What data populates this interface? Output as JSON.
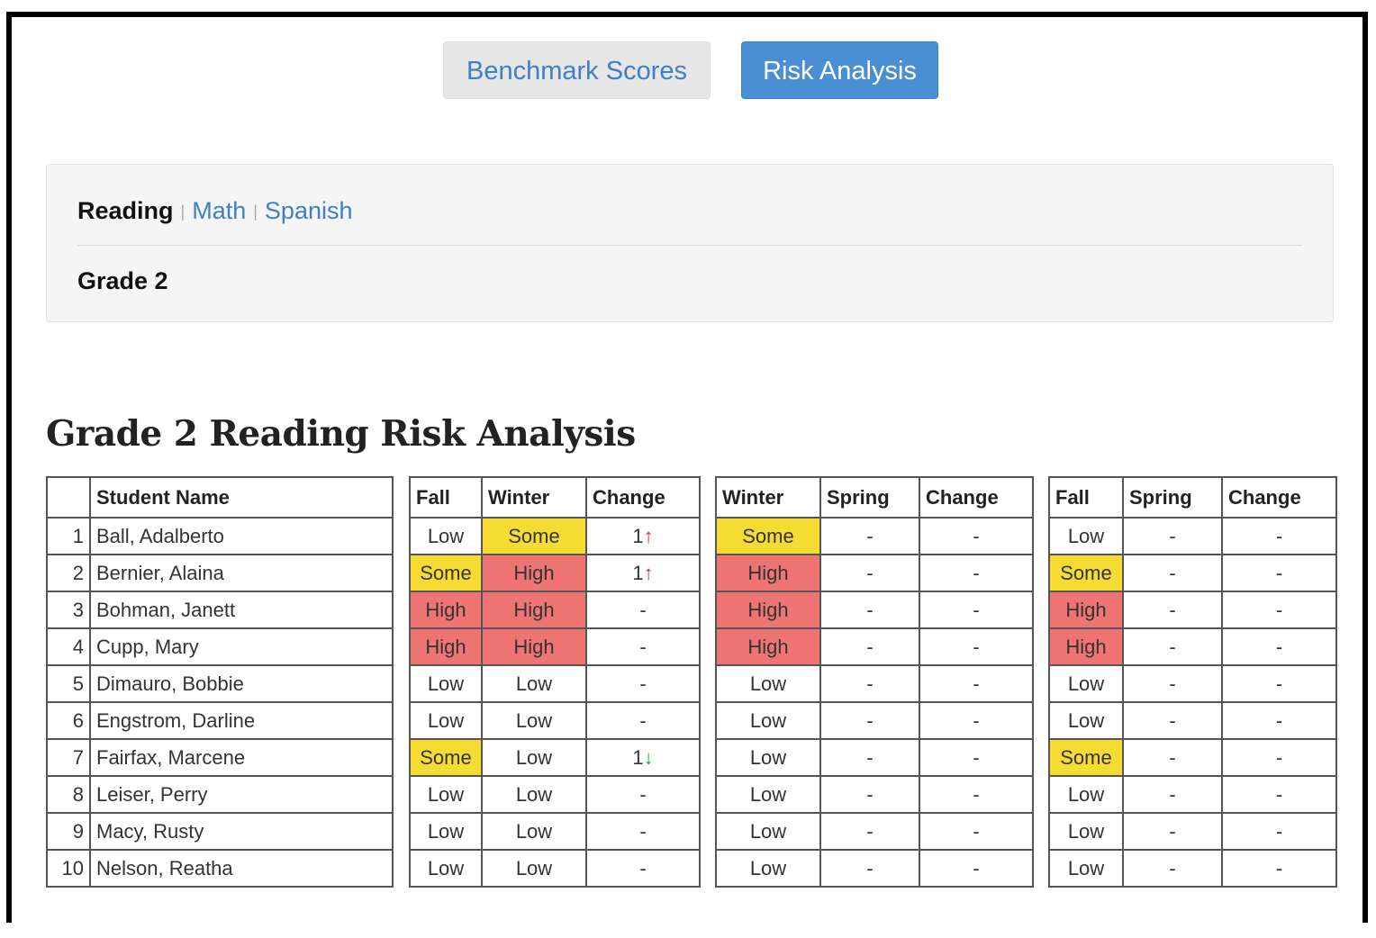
{
  "tabs": {
    "benchmark_label": "Benchmark Scores",
    "risk_label": "Risk Analysis"
  },
  "filters": {
    "subjects": [
      "Reading",
      "Math",
      "Spanish"
    ],
    "active_subject": "Reading",
    "grade_label": "Grade 2"
  },
  "heading": "Grade 2 Reading Risk Analysis",
  "colors": {
    "some": "#f6dc32",
    "high": "#ef7474",
    "accent": "#4a8fd4",
    "arrow_up": "#d4302c",
    "arrow_down": "#2c9a3a"
  },
  "students": {
    "index_header": "",
    "name_header": "Student Name",
    "rows": [
      {
        "n": "1",
        "name": "Ball, Adalberto"
      },
      {
        "n": "2",
        "name": "Bernier, Alaina"
      },
      {
        "n": "3",
        "name": "Bohman, Janett"
      },
      {
        "n": "4",
        "name": "Cupp, Mary"
      },
      {
        "n": "5",
        "name": "Dimauro, Bobbie"
      },
      {
        "n": "6",
        "name": "Engstrom, Darline"
      },
      {
        "n": "7",
        "name": "Fairfax, Marcene"
      },
      {
        "n": "8",
        "name": "Leiser, Perry"
      },
      {
        "n": "9",
        "name": "Macy, Rusty"
      },
      {
        "n": "10",
        "name": "Nelson, Reatha"
      }
    ]
  },
  "risk_tables": [
    {
      "key": "fall-winter",
      "headers": [
        "Fall",
        "Winter",
        "Change"
      ],
      "rows": [
        [
          "Low",
          "Some",
          "1↑"
        ],
        [
          "Some",
          "High",
          "1↑"
        ],
        [
          "High",
          "High",
          "-"
        ],
        [
          "High",
          "High",
          "-"
        ],
        [
          "Low",
          "Low",
          "-"
        ],
        [
          "Low",
          "Low",
          "-"
        ],
        [
          "Some",
          "Low",
          "1↓"
        ],
        [
          "Low",
          "Low",
          "-"
        ],
        [
          "Low",
          "Low",
          "-"
        ],
        [
          "Low",
          "Low",
          "-"
        ]
      ]
    },
    {
      "key": "winter-spring",
      "headers": [
        "Winter",
        "Spring",
        "Change"
      ],
      "rows": [
        [
          "Some",
          "-",
          "-"
        ],
        [
          "High",
          "-",
          "-"
        ],
        [
          "High",
          "-",
          "-"
        ],
        [
          "High",
          "-",
          "-"
        ],
        [
          "Low",
          "-",
          "-"
        ],
        [
          "Low",
          "-",
          "-"
        ],
        [
          "Low",
          "-",
          "-"
        ],
        [
          "Low",
          "-",
          "-"
        ],
        [
          "Low",
          "-",
          "-"
        ],
        [
          "Low",
          "-",
          "-"
        ]
      ]
    },
    {
      "key": "fall-spring",
      "headers": [
        "Fall",
        "Spring",
        "Change"
      ],
      "rows": [
        [
          "Low",
          "-",
          "-"
        ],
        [
          "Some",
          "-",
          "-"
        ],
        [
          "High",
          "-",
          "-"
        ],
        [
          "High",
          "-",
          "-"
        ],
        [
          "Low",
          "-",
          "-"
        ],
        [
          "Low",
          "-",
          "-"
        ],
        [
          "Some",
          "-",
          "-"
        ],
        [
          "Low",
          "-",
          "-"
        ],
        [
          "Low",
          "-",
          "-"
        ],
        [
          "Low",
          "-",
          "-"
        ]
      ]
    }
  ]
}
